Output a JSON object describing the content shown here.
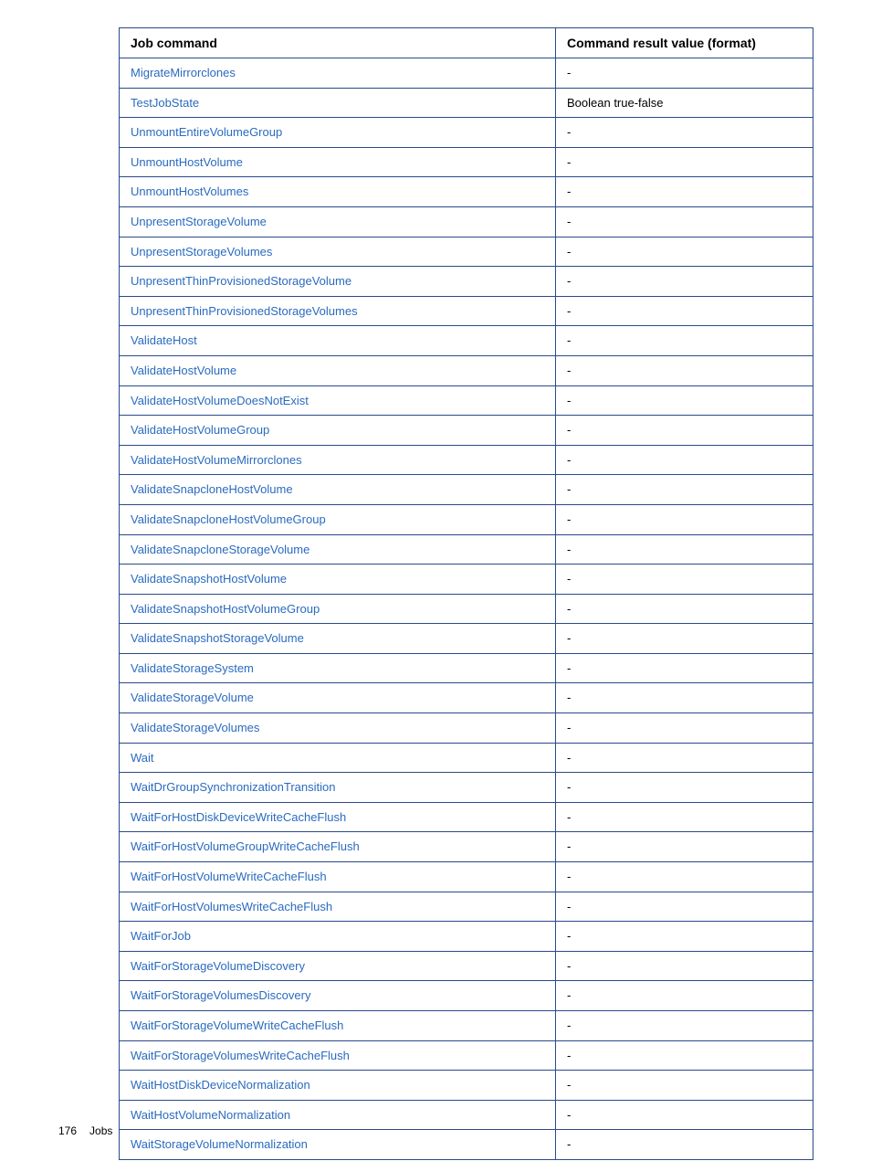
{
  "table": {
    "headers": {
      "command": "Job command",
      "result": "Command result value (format)"
    },
    "rows": [
      {
        "command": "MigrateMirrorclones",
        "result": "-"
      },
      {
        "command": "TestJobState",
        "result": "Boolean true-false"
      },
      {
        "command": "UnmountEntireVolumeGroup",
        "result": "-"
      },
      {
        "command": "UnmountHostVolume",
        "result": "-"
      },
      {
        "command": "UnmountHostVolumes",
        "result": "-"
      },
      {
        "command": "UnpresentStorageVolume",
        "result": "-"
      },
      {
        "command": "UnpresentStorageVolumes",
        "result": "-"
      },
      {
        "command": "UnpresentThinProvisionedStorageVolume",
        "result": "-"
      },
      {
        "command": "UnpresentThinProvisionedStorageVolumes",
        "result": "-"
      },
      {
        "command": "ValidateHost",
        "result": "-"
      },
      {
        "command": "ValidateHostVolume",
        "result": "-"
      },
      {
        "command": "ValidateHostVolumeDoesNotExist",
        "result": "-"
      },
      {
        "command": "ValidateHostVolumeGroup",
        "result": "-"
      },
      {
        "command": "ValidateHostVolumeMirrorclones",
        "result": "-"
      },
      {
        "command": "ValidateSnapcloneHostVolume",
        "result": "-"
      },
      {
        "command": "ValidateSnapcloneHostVolumeGroup",
        "result": "-"
      },
      {
        "command": "ValidateSnapcloneStorageVolume",
        "result": "-"
      },
      {
        "command": "ValidateSnapshotHostVolume",
        "result": "-"
      },
      {
        "command": "ValidateSnapshotHostVolumeGroup",
        "result": "-"
      },
      {
        "command": "ValidateSnapshotStorageVolume",
        "result": "-"
      },
      {
        "command": "ValidateStorageSystem",
        "result": "-"
      },
      {
        "command": "ValidateStorageVolume",
        "result": "-"
      },
      {
        "command": "ValidateStorageVolumes",
        "result": "-"
      },
      {
        "command": "Wait",
        "result": "-"
      },
      {
        "command": "WaitDrGroupSynchronizationTransition",
        "result": "-"
      },
      {
        "command": "WaitForHostDiskDeviceWriteCacheFlush",
        "result": "-"
      },
      {
        "command": "WaitForHostVolumeGroupWriteCacheFlush",
        "result": "-"
      },
      {
        "command": "WaitForHostVolumeWriteCacheFlush",
        "result": "-"
      },
      {
        "command": "WaitForHostVolumesWriteCacheFlush",
        "result": "-"
      },
      {
        "command": "WaitForJob",
        "result": "-"
      },
      {
        "command": "WaitForStorageVolumeDiscovery",
        "result": "-"
      },
      {
        "command": "WaitForStorageVolumesDiscovery",
        "result": "-"
      },
      {
        "command": "WaitForStorageVolumeWriteCacheFlush",
        "result": "-"
      },
      {
        "command": "WaitForStorageVolumesWriteCacheFlush",
        "result": "-"
      },
      {
        "command": "WaitHostDiskDeviceNormalization",
        "result": "-"
      },
      {
        "command": "WaitHostVolumeNormalization",
        "result": "-"
      },
      {
        "command": "WaitStorageVolumeNormalization",
        "result": "-"
      }
    ]
  },
  "footer": {
    "page_number": "176",
    "section": "Jobs"
  }
}
